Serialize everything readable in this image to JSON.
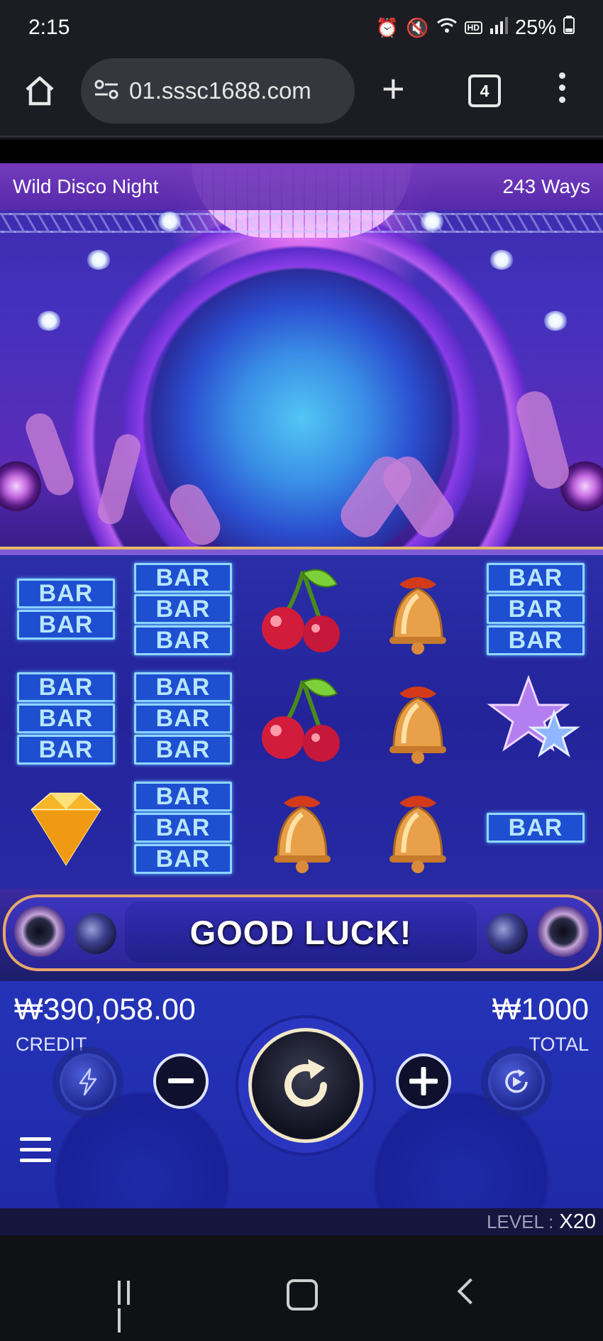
{
  "status_bar": {
    "time": "2:15",
    "battery": "25%",
    "hd_label": "HD",
    "icons": [
      "alarm-icon",
      "mute-icon",
      "wifi-icon",
      "hd-voice-icon",
      "signal-icon",
      "battery-icon"
    ]
  },
  "browser": {
    "url": "01.sssc1688.com",
    "tab_count": "4",
    "icons": [
      "home-icon",
      "site-settings-icon",
      "new-tab-icon",
      "tabs-icon",
      "more-icon"
    ]
  },
  "game": {
    "title": "Wild Disco Night",
    "ways": "243 Ways",
    "reels": [
      [
        "bar-double",
        "bar-triple",
        "diamond"
      ],
      [
        "bar-triple",
        "bar-triple",
        "bar-triple"
      ],
      [
        "cherry",
        "cherry",
        "bell"
      ],
      [
        "bell",
        "bell",
        "bell"
      ],
      [
        "bar-triple",
        "star",
        "bar-single"
      ]
    ],
    "bar_label": "BAR",
    "message": "GOOD LUCK!",
    "credit_value": "₩390,058.00",
    "credit_label": "CREDIT",
    "total_value": "₩1000",
    "total_label": "TOTAL",
    "level_label": "LEVEL :",
    "level_value": "X20",
    "controls": [
      "turbo-icon",
      "minus-icon",
      "spin-icon",
      "plus-icon",
      "autoplay-icon",
      "menu-icon"
    ]
  },
  "colors": {
    "reel_bg": "#24239a",
    "bar_fill": "#1e4fd0",
    "frame_gold": "#e7a86a"
  }
}
